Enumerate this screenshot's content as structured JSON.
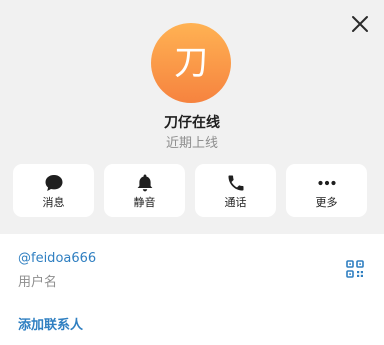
{
  "profile": {
    "avatar_letter": "刀",
    "name": "刀仔在线",
    "status": "近期上线"
  },
  "actions": [
    {
      "icon": "message-icon",
      "label": "消息"
    },
    {
      "icon": "bell-icon",
      "label": "静音"
    },
    {
      "icon": "phone-icon",
      "label": "通话"
    },
    {
      "icon": "more-icon",
      "label": "更多"
    }
  ],
  "info": {
    "username": "@feidoa666",
    "username_label": "用户名",
    "add_contact": "添加联系人"
  },
  "colors": {
    "accent": "#2f7fc1",
    "avatar_top": "#ffb253",
    "avatar_bottom": "#f6833f",
    "header_bg": "#f1f1f1"
  }
}
